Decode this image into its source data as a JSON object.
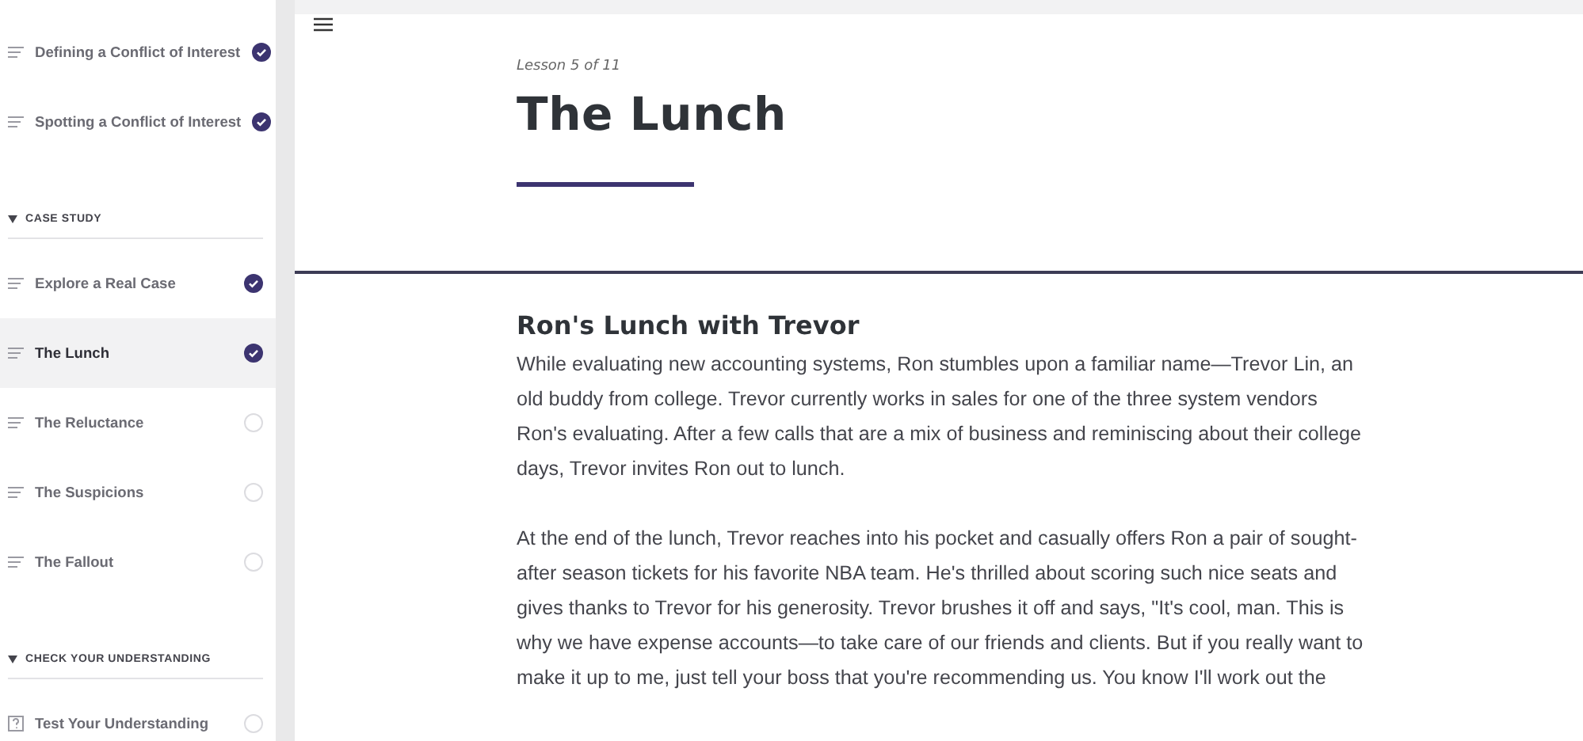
{
  "sidebar": {
    "items": [
      {
        "kind": "lesson",
        "label": "Defining a Conflict of Interest",
        "completed": true,
        "selected": false
      },
      {
        "kind": "lesson",
        "label": "Spotting a Conflict of Interest",
        "completed": true,
        "selected": false
      },
      {
        "kind": "section",
        "label": "CASE STUDY",
        "expanded": true
      },
      {
        "kind": "lesson",
        "label": "Explore a Real Case",
        "completed": true,
        "selected": false
      },
      {
        "kind": "lesson",
        "label": "The Lunch",
        "completed": true,
        "selected": true
      },
      {
        "kind": "lesson",
        "label": "The Reluctance",
        "completed": false,
        "selected": false
      },
      {
        "kind": "lesson",
        "label": "The Suspicions",
        "completed": false,
        "selected": false
      },
      {
        "kind": "lesson",
        "label": "The Fallout",
        "completed": false,
        "selected": false
      },
      {
        "kind": "section",
        "label": "CHECK YOUR UNDERSTANDING",
        "expanded": true
      },
      {
        "kind": "quiz",
        "label": "Test Your Understanding",
        "completed": false,
        "selected": false
      }
    ]
  },
  "lesson": {
    "counter": "Lesson 5 of 11",
    "title": "The Lunch",
    "heading": "Ron's Lunch with Trevor",
    "paragraphs": [
      "While evaluating new accounting systems, Ron stumbles upon a familiar name—Trevor Lin, an old buddy from college. Trevor currently works in sales for one of the three system vendors Ron's evaluating. After a few calls that are a mix of business and reminiscing about their college days, Trevor invites Ron out to lunch.",
      "At the end of the lunch, Trevor reaches into his pocket and casually offers Ron a pair of sought-after season tickets for his favorite NBA team. He's thrilled about scoring such nice seats and gives thanks to Trevor for his generosity. Trevor brushes it off and says, \"It's cool, man. This is why we have expense accounts—to take care of our friends and clients. But if you really want to make it up to me, just tell your boss that you're recommending us. You know I'll work out the"
    ]
  }
}
